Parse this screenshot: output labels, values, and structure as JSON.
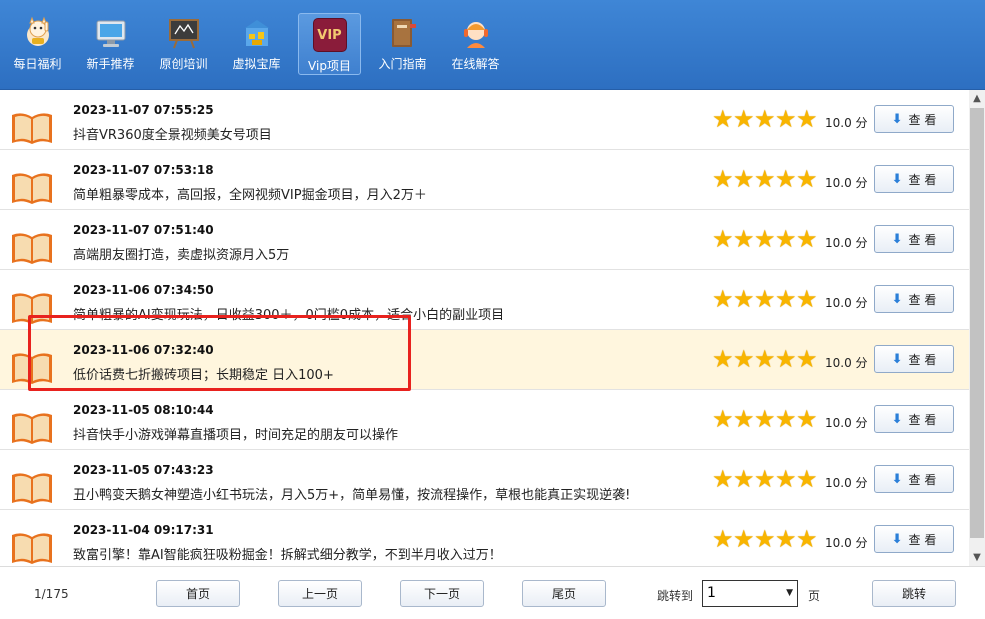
{
  "toolbar": {
    "items": [
      {
        "label": "每日福利",
        "icon": "lucky-cat-icon"
      },
      {
        "label": "新手推荐",
        "icon": "monitor-icon"
      },
      {
        "label": "原创培训",
        "icon": "blackboard-icon"
      },
      {
        "label": "虚拟宝库",
        "icon": "treasure-box-icon"
      },
      {
        "label": "Vip项目",
        "icon": "vip-icon",
        "icon_text": "VIP",
        "active": true
      },
      {
        "label": "入门指南",
        "icon": "guide-book-icon"
      },
      {
        "label": "在线解答",
        "icon": "support-agent-icon"
      }
    ]
  },
  "list": {
    "view_label": "查 看",
    "score_unit": "分",
    "rows": [
      {
        "time": "2023-11-07 07:55:25",
        "title": "抖音VR360度全景视频美女号项目",
        "rating": 5,
        "score": "10.0"
      },
      {
        "time": "2023-11-07 07:53:18",
        "title": "简单粗暴零成本，高回报，全网视频VIP掘金项目，月入2万＋",
        "rating": 5,
        "score": "10.0"
      },
      {
        "time": "2023-11-07 07:51:40",
        "title": "高端朋友圈打造，卖虚拟资源月入5万",
        "rating": 5,
        "score": "10.0"
      },
      {
        "time": "2023-11-06 07:34:50",
        "title": "简单粗暴的AI变现玩法，日收益300＋，0门槛0成本，适合小白的副业项目",
        "rating": 5,
        "score": "10.0"
      },
      {
        "time": "2023-11-06 07:32:40",
        "title": "低价话费七折搬砖项目；长期稳定 日入100+",
        "rating": 5,
        "score": "10.0",
        "selected": true
      },
      {
        "time": "2023-11-05 08:10:44",
        "title": "抖音快手小游戏弹幕直播项目，时间充足的朋友可以操作",
        "rating": 5,
        "score": "10.0"
      },
      {
        "time": "2023-11-05 07:43:23",
        "title": "丑小鸭变天鹅女神塑造小红书玩法，月入5万+，简单易懂，按流程操作，草根也能真正实现逆袭!",
        "rating": 5,
        "score": "10.0"
      },
      {
        "time": "2023-11-04 09:17:31",
        "title": "致富引擎！靠AI智能疯狂吸粉掘金！拆解式细分教学，不到半月收入过万！",
        "rating": 5,
        "score": "10.0"
      }
    ]
  },
  "pager": {
    "page_info": "1/175",
    "first": "首页",
    "prev": "上一页",
    "next": "下一页",
    "last": "尾页",
    "jump_to_label": "跳转到",
    "selected_page": "1",
    "page_unit": "页",
    "jump_button": "跳转"
  },
  "colors": {
    "accent": "#2d6fc1",
    "star": "#f8b500",
    "highlight": "#e8221e",
    "selected_row": "#fff6de"
  }
}
